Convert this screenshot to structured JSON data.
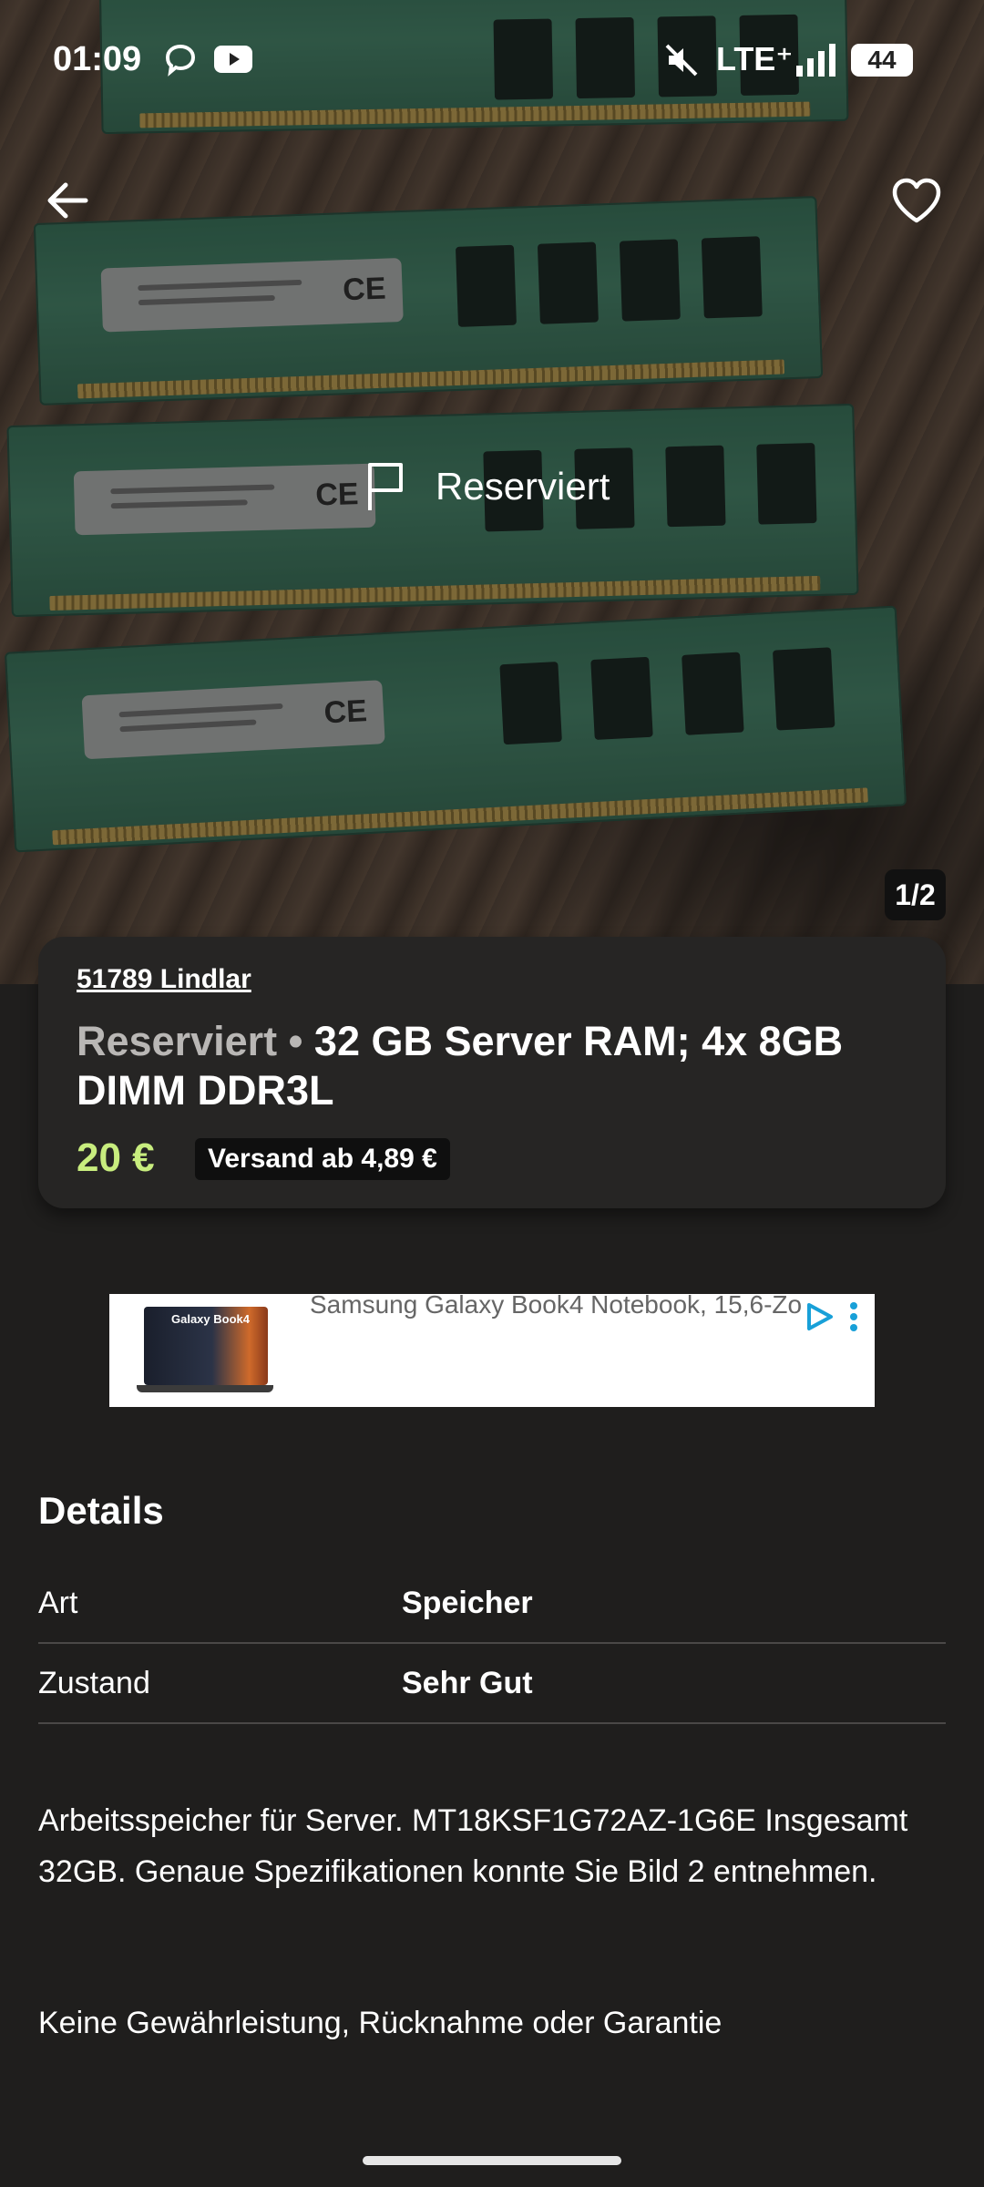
{
  "status_bar": {
    "time": "01:09",
    "network": "LTE⁺",
    "battery": "44"
  },
  "hero": {
    "overlay_status": "Reserviert",
    "image_counter": "1/2"
  },
  "listing": {
    "location": "51789 Lindlar",
    "status_prefix": "Reserviert",
    "separator": " • ",
    "title": "32 GB Server RAM; 4x 8GB DIMM DDR3L",
    "price": "20 €",
    "shipping": "Versand ab 4,89 €",
    "price_color": "#c8ed7e"
  },
  "ad": {
    "headline": "Samsung Galaxy Book4 Notebook, 15,6-Zo",
    "image_label": "Galaxy Book4"
  },
  "details": {
    "heading": "Details",
    "rows": [
      {
        "key": "Art",
        "value": "Speicher"
      },
      {
        "key": "Zustand",
        "value": "Sehr Gut"
      }
    ]
  },
  "description": {
    "paragraph1": "Arbeitsspeicher für Server. MT18KSF1G72AZ-1G6E Insgesamt 32GB. Genaue Spezifikationen konnte Sie Bild 2 entnehmen.",
    "paragraph2": "Keine Gewährleistung, Rücknahme oder Garantie"
  },
  "icons": {
    "back": "arrow-left-icon",
    "favorite": "heart-icon",
    "reserved": "flag-icon",
    "chat": "chat-bubble-icon",
    "youtube": "youtube-icon",
    "mute": "mute-icon",
    "signal": "signal-icon"
  }
}
